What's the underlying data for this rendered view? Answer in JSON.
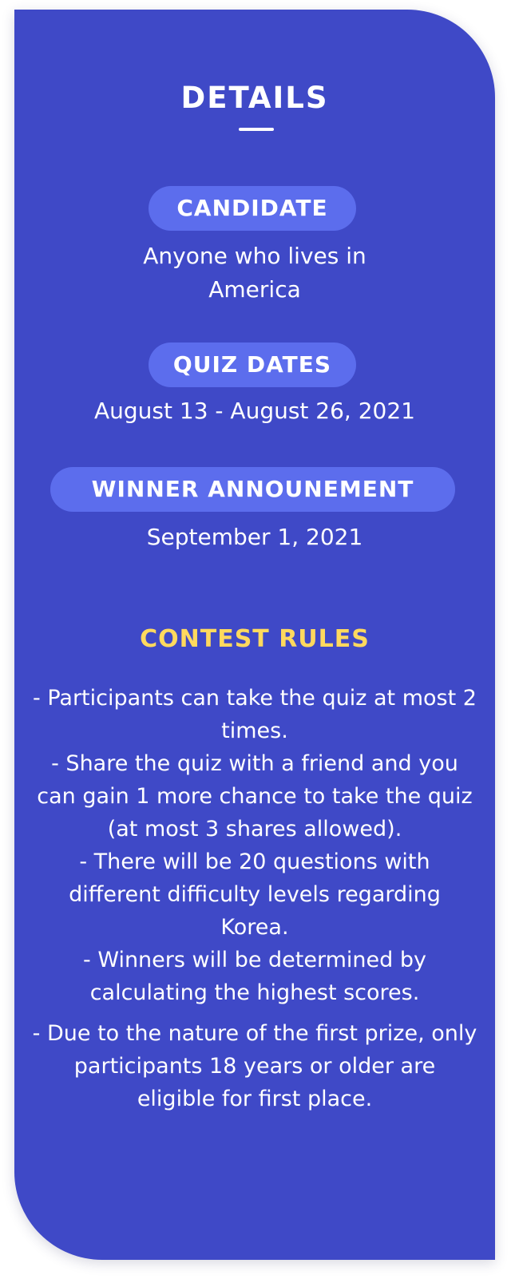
{
  "details": {
    "title": "DETAILS",
    "sections": [
      {
        "label": "CANDIDATE",
        "value": "Anyone who lives in America"
      },
      {
        "label": "QUIZ DATES",
        "value": "August 13 - August 26, 2021"
      },
      {
        "label": "WINNER ANNOUNEMENT",
        "value": "September 1, 2021"
      }
    ]
  },
  "rules": {
    "heading": "CONTEST RULES",
    "items": [
      "- Participants can take the quiz at most 2 times.",
      "- Share the quiz with a friend and you can gain 1 more chance to take the quiz (at most 3 shares allowed).",
      "- There will be 20 questions with different difficulty levels regarding Korea.",
      "- Winners will be determined by calculating the highest scores.",
      "- Due to the nature of the first prize, only participants 18 years or older are eligible for first place."
    ]
  },
  "colors": {
    "card_background": "#3f49c7",
    "pill_background": "#5c6ded",
    "rules_heading": "#ffd95e",
    "text": "#ffffff"
  }
}
